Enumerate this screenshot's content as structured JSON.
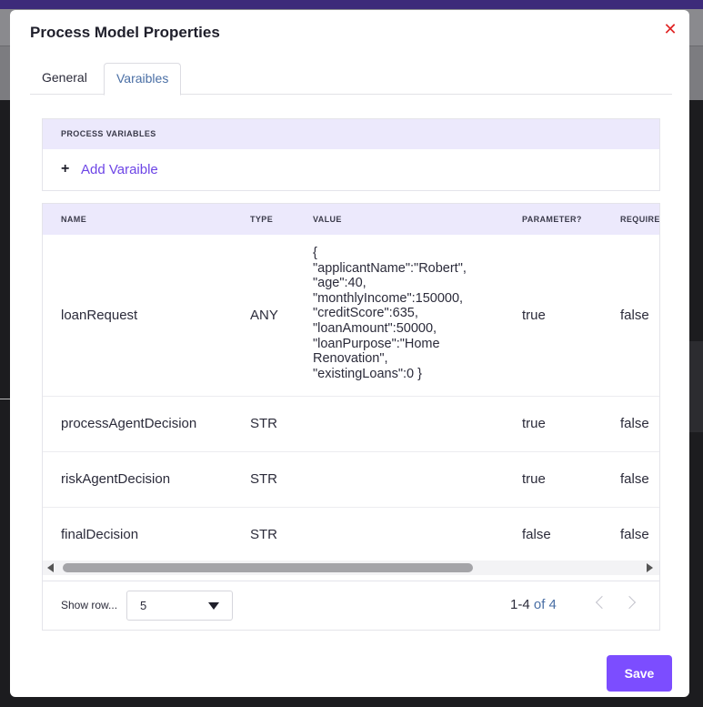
{
  "modal": {
    "title": "Process Model Properties",
    "close_glyph": "✕",
    "save_label": "Save"
  },
  "tabs": [
    {
      "label": "General",
      "active": false
    },
    {
      "label": "Varaibles",
      "active": true
    }
  ],
  "process_variables": {
    "header": "PROCESS VARIABLES",
    "add_label": "Add Varaible"
  },
  "table": {
    "columns": [
      "NAME",
      "TYPE",
      "VALUE",
      "PARAMETER?",
      "REQUIRE"
    ],
    "rows": [
      {
        "name": "loanRequest",
        "type": "ANY",
        "value": "{\n\"applicantName\":\"Robert\",\n\"age\":40,\n\"monthlyIncome\":150000,\n\"creditScore\":635,\n\"loanAmount\":50000,\n\"loanPurpose\":\"Home\nRenovation\",\n\"existingLoans\":0 }",
        "parameter": "true",
        "required": "false"
      },
      {
        "name": "processAgentDecision",
        "type": "STR",
        "value": "",
        "parameter": "true",
        "required": "false"
      },
      {
        "name": "riskAgentDecision",
        "type": "STR",
        "value": "",
        "parameter": "true",
        "required": "false"
      },
      {
        "name": "finalDecision",
        "type": "STR",
        "value": "",
        "parameter": "false",
        "required": "false"
      }
    ]
  },
  "pagination": {
    "show_rows_label": "Show row...",
    "rows_per_page": "5",
    "range": "1-4",
    "of_total": "of 4"
  },
  "colors": {
    "accent": "#7c4dff",
    "header_bg": "#ece9fc",
    "close": "#e02424"
  }
}
